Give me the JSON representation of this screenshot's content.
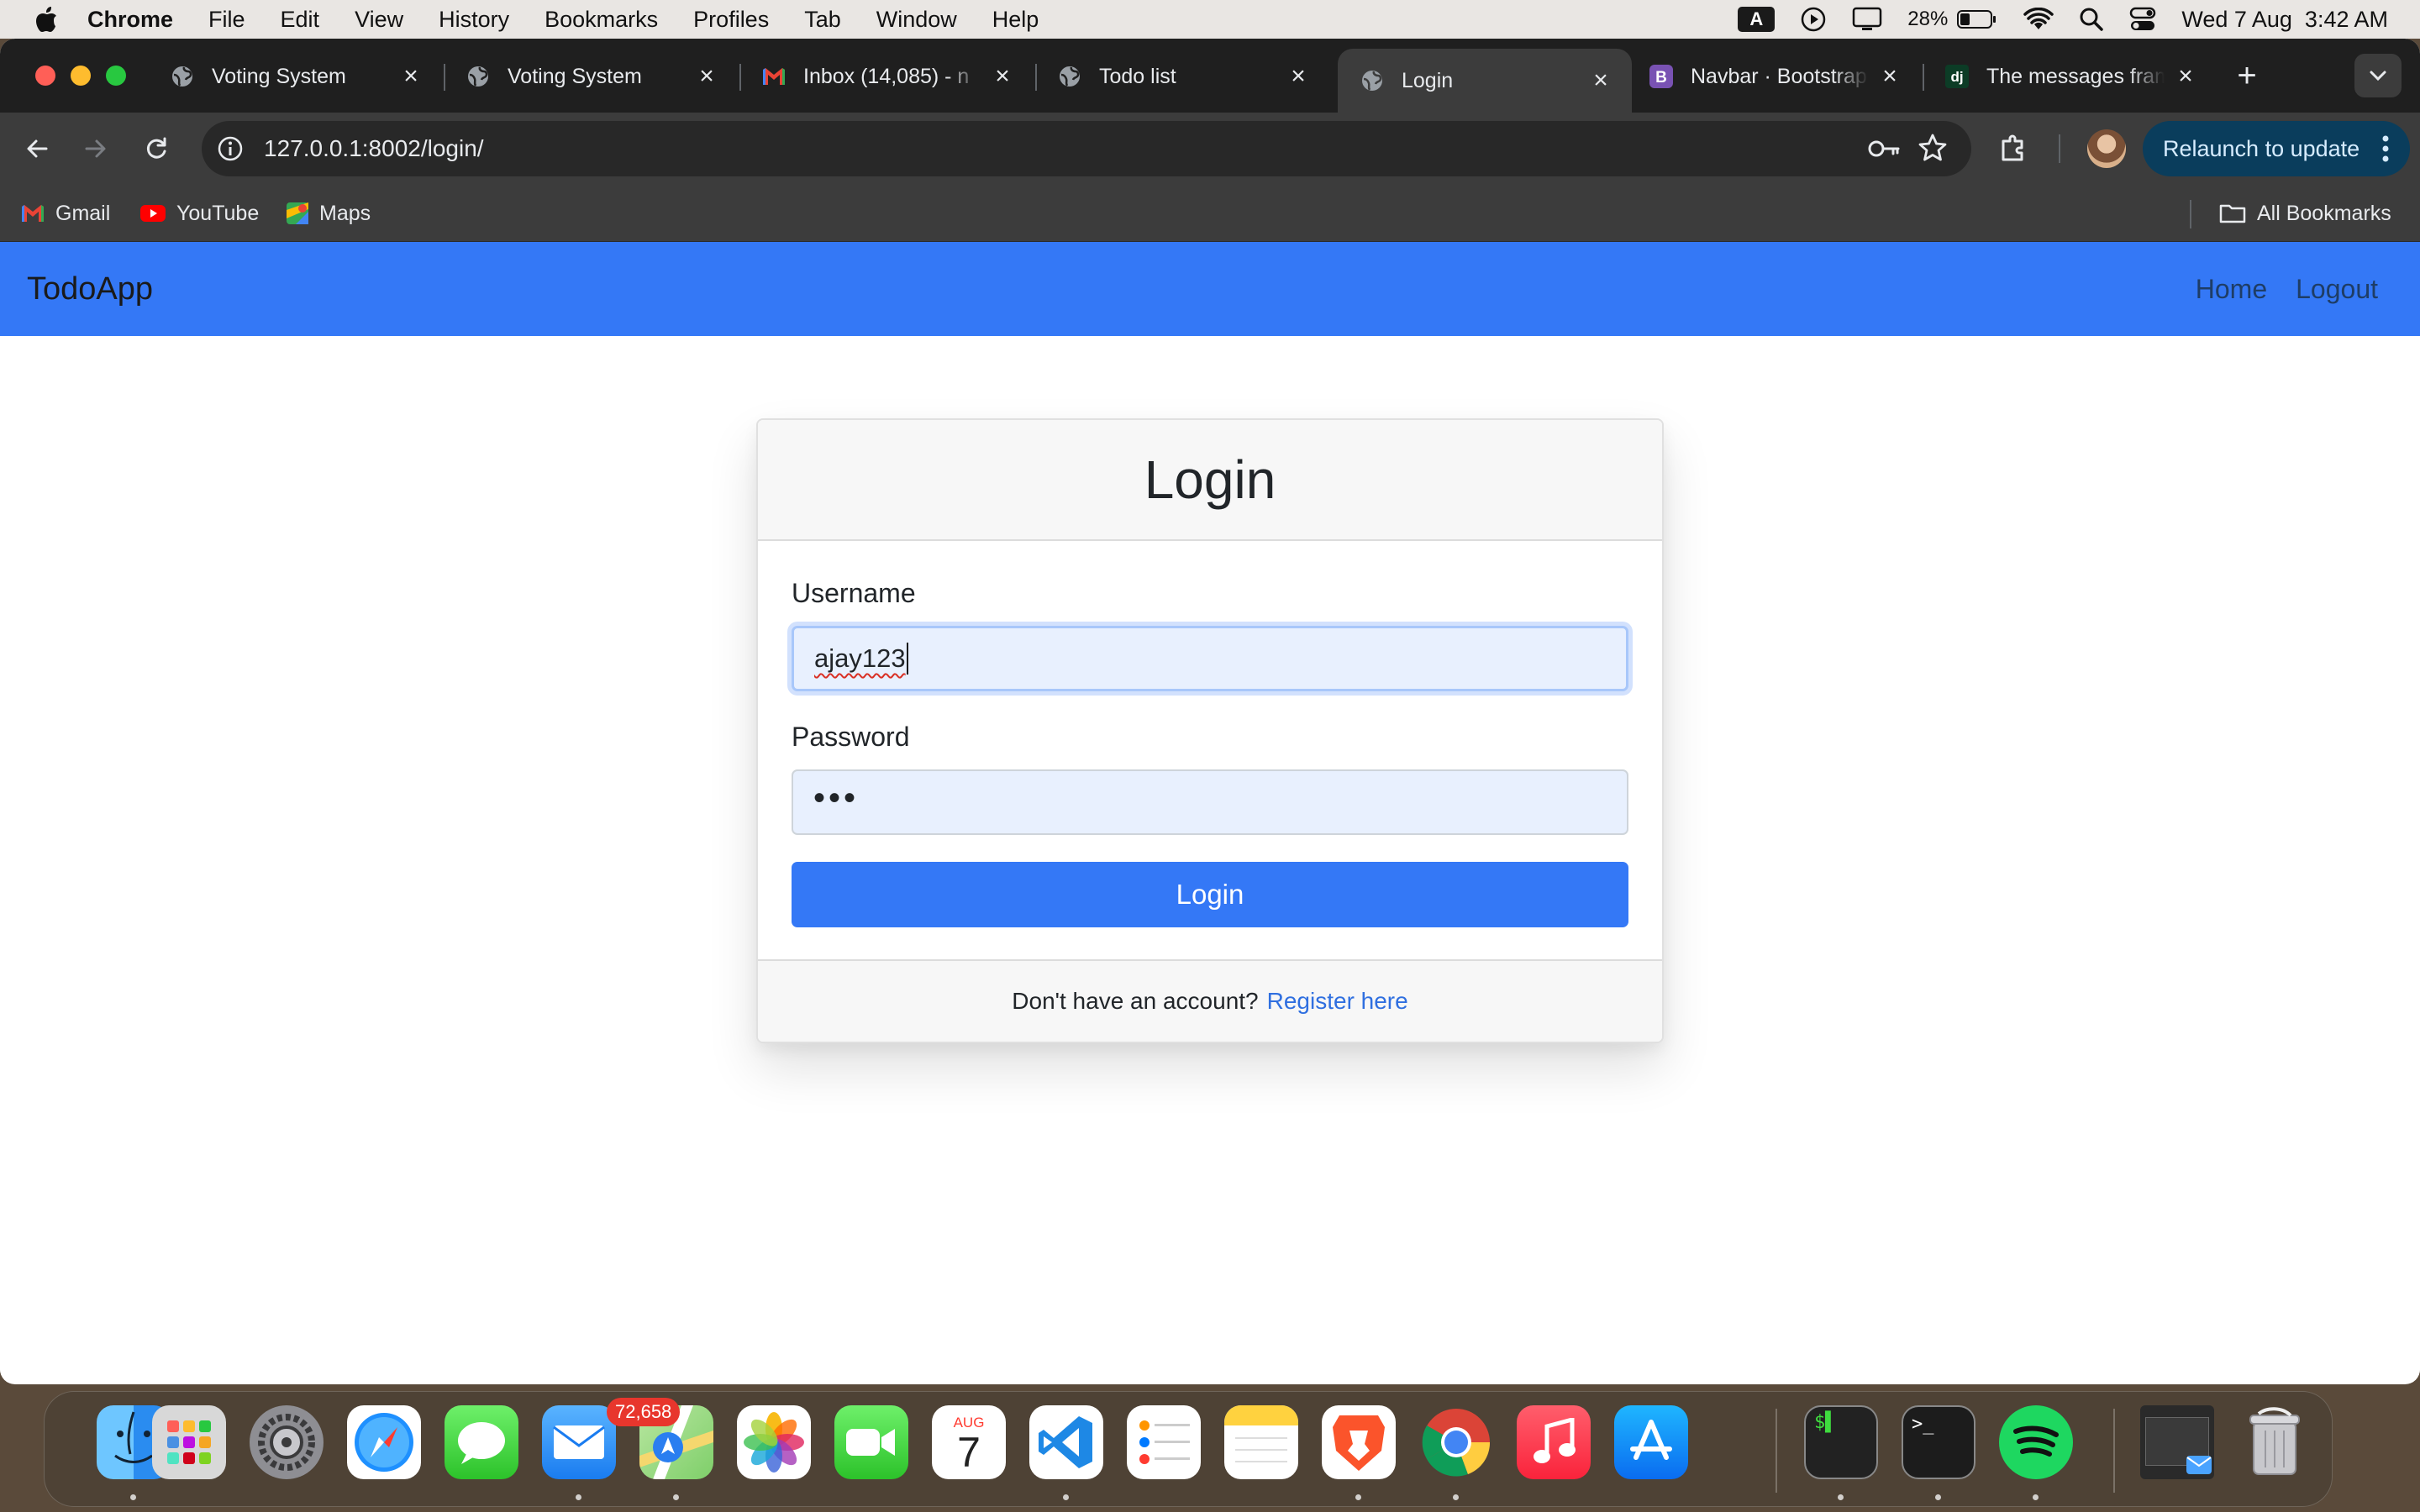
{
  "menubar": {
    "app_name": "Chrome",
    "items": [
      "File",
      "Edit",
      "View",
      "History",
      "Bookmarks",
      "Profiles",
      "Tab",
      "Window",
      "Help"
    ],
    "input_source": "A",
    "battery": "28%",
    "datetime": "Wed 7 Aug  3:42 AM"
  },
  "tabs": [
    {
      "title": "Voting System",
      "favicon": "globe-icon"
    },
    {
      "title": "Voting System",
      "favicon": "globe-icon"
    },
    {
      "title": "Inbox (14,085) - n",
      "favicon": "gmail-icon"
    },
    {
      "title": "Todo list",
      "favicon": "globe-icon"
    },
    {
      "title": "Login",
      "favicon": "globe-icon",
      "active": true
    },
    {
      "title": "Navbar · Bootstrap",
      "favicon": "bootstrap-icon"
    },
    {
      "title": "The messages fram",
      "favicon": "django-icon"
    }
  ],
  "toolbar": {
    "url": "127.0.0.1:8002/login/",
    "relaunch_label": "Relaunch to update"
  },
  "bookmarks": {
    "items": [
      {
        "label": "Gmail",
        "icon": "gmail-icon"
      },
      {
        "label": "YouTube",
        "icon": "youtube-icon"
      },
      {
        "label": "Maps",
        "icon": "maps-icon"
      }
    ],
    "all_label": "All Bookmarks"
  },
  "navbar": {
    "brand": "TodoApp",
    "links": [
      "Home",
      "Logout"
    ],
    "bg_color": "#3478f6"
  },
  "login": {
    "title": "Login",
    "username_label": "Username",
    "username_value": "ajay123",
    "password_label": "Password",
    "password_value": "•••",
    "submit_label": "Login",
    "footer_text": "Don't have an account?",
    "footer_link": "Register here"
  },
  "dock": {
    "apps": [
      "finder",
      "launchpad",
      "system-settings",
      "safari",
      "messages",
      "mail",
      "maps",
      "photos",
      "facetime",
      "calendar",
      "vscode",
      "reminders",
      "notes",
      "brave",
      "chrome",
      "music",
      "app-store",
      "iterm",
      "terminal",
      "spotify",
      "preview-window",
      "trash"
    ],
    "mail_badge": "72,658",
    "calendar_month": "AUG",
    "calendar_day": "7"
  }
}
